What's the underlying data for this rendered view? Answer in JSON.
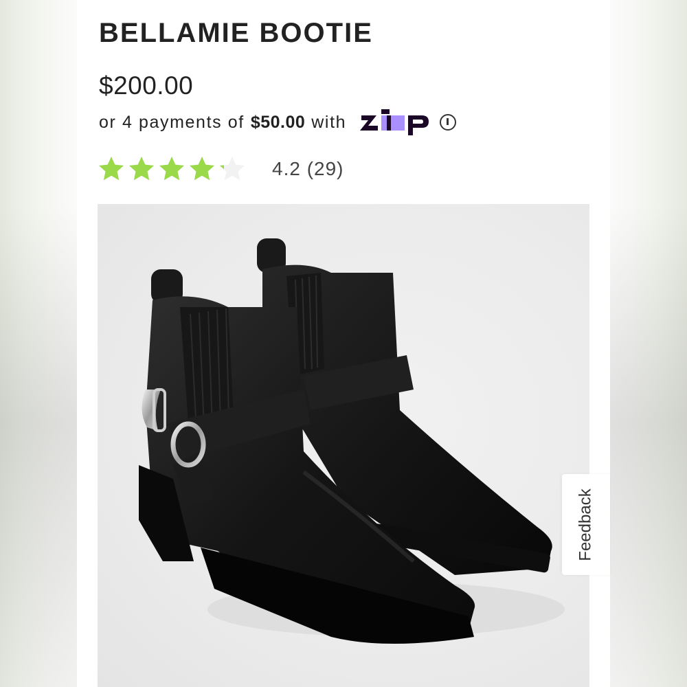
{
  "product": {
    "title": "BELLAMIE BOOTIE",
    "price": "$200.00",
    "installment": {
      "prefix": "or 4 payments of",
      "amount": "$50.00",
      "suffix": "with",
      "provider": "Zip"
    },
    "rating": {
      "value": 4.2,
      "text": "4.2 (29)",
      "max_stars": 5
    },
    "image": {
      "icon": "ankle-boots-image"
    }
  },
  "feedback": {
    "label": "Feedback"
  },
  "colors": {
    "star_fill": "#9ad94a",
    "star_empty": "#f2f2f2",
    "zip_purple": "#aa8fff",
    "zip_dark": "#1a0826",
    "boot_leather": "#1a1a1a"
  }
}
